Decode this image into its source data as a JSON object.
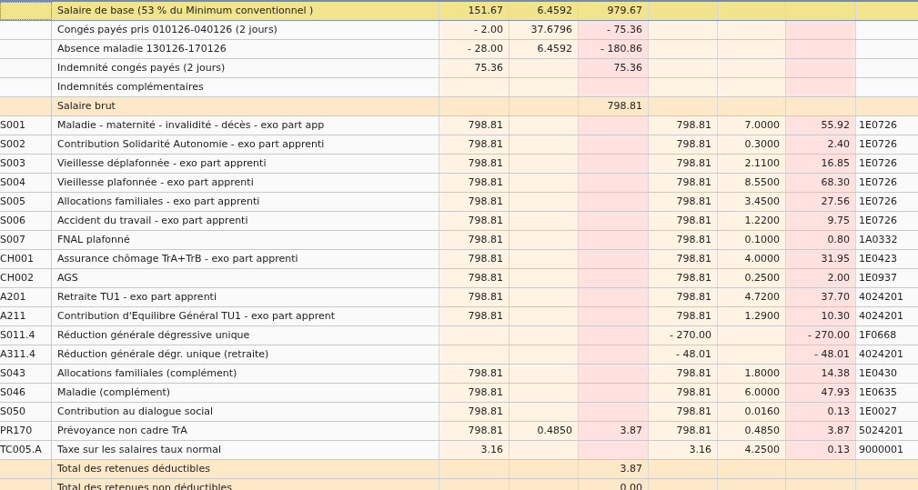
{
  "rows": [
    {
      "kind": "header",
      "focused": true,
      "cells": {
        "label": "Salaire de base (53 % du Minimum conventionnel )",
        "base": "151.67",
        "rate": "6.4592",
        "amount": "979.67"
      }
    },
    {
      "kind": "line",
      "cells": {
        "label": "Congés payés pris 010126-040126 (2 jours)",
        "base": "- 2.00",
        "rate": "37.6796",
        "amount": "- 75.36"
      }
    },
    {
      "kind": "line",
      "cells": {
        "label": "Absence maladie 130126-170126",
        "base": "- 28.00",
        "rate": "6.4592",
        "amount": "- 180.86"
      }
    },
    {
      "kind": "line",
      "cells": {
        "label": "Indemnité congés payés (2 jours)",
        "base": "75.36",
        "amount": "75.36"
      }
    },
    {
      "kind": "line",
      "cells": {
        "label": "Indemnités complémentaires"
      }
    },
    {
      "kind": "total",
      "cells": {
        "label": "Salaire brut",
        "amount": "798.81"
      }
    },
    {
      "kind": "line",
      "cells": {
        "code": "S001",
        "label": "Maladie - maternité - invalidité - décès - exo part app",
        "base": "798.81",
        "employer_base": "798.81",
        "employer_rate": "7.0000",
        "employer_amount": "55.92",
        "column_9": "1E0726"
      }
    },
    {
      "kind": "line",
      "cells": {
        "code": "S002",
        "label": "Contribution Solidarité Autonomie - exo part apprenti",
        "base": "798.81",
        "employer_base": "798.81",
        "employer_rate": "0.3000",
        "employer_amount": "2.40",
        "column_9": "1E0726"
      }
    },
    {
      "kind": "line",
      "cells": {
        "code": "S003",
        "label": "Vieillesse déplafonnée - exo part apprenti",
        "base": "798.81",
        "employer_base": "798.81",
        "employer_rate": "2.1100",
        "employer_amount": "16.85",
        "column_9": "1E0726"
      }
    },
    {
      "kind": "line",
      "cells": {
        "code": "S004",
        "label": "Vieillesse plafonnée - exo part apprenti",
        "base": "798.81",
        "employer_base": "798.81",
        "employer_rate": "8.5500",
        "employer_amount": "68.30",
        "column_9": "1E0726"
      }
    },
    {
      "kind": "line",
      "cells": {
        "code": "S005",
        "label": "Allocations familiales - exo part apprenti",
        "base": "798.81",
        "employer_base": "798.81",
        "employer_rate": "3.4500",
        "employer_amount": "27.56",
        "column_9": "1E0726"
      }
    },
    {
      "kind": "line",
      "cells": {
        "code": "S006",
        "label": "Accident du travail - exo part apprenti",
        "base": "798.81",
        "employer_base": "798.81",
        "employer_rate": "1.2200",
        "employer_amount": "9.75",
        "column_9": "1E0726"
      }
    },
    {
      "kind": "line",
      "cells": {
        "code": "S007",
        "label": "FNAL plafonné",
        "base": "798.81",
        "employer_base": "798.81",
        "employer_rate": "0.1000",
        "employer_amount": "0.80",
        "column_9": "1A0332"
      }
    },
    {
      "kind": "line",
      "cells": {
        "code": "CH001",
        "label": "Assurance chômage TrA+TrB - exo part apprenti",
        "base": "798.81",
        "employer_base": "798.81",
        "employer_rate": "4.0000",
        "employer_amount": "31.95",
        "column_9": "1E0423"
      }
    },
    {
      "kind": "line",
      "cells": {
        "code": "CH002",
        "label": "AGS",
        "base": "798.81",
        "employer_base": "798.81",
        "employer_rate": "0.2500",
        "employer_amount": "2.00",
        "column_9": "1E0937"
      }
    },
    {
      "kind": "line",
      "cells": {
        "code": "A201",
        "label": "Retraite TU1 - exo part apprenti",
        "base": "798.81",
        "employer_base": "798.81",
        "employer_rate": "4.7200",
        "employer_amount": "37.70",
        "column_9": "4024201"
      }
    },
    {
      "kind": "line",
      "cells": {
        "code": "A211",
        "label": "Contribution d'Equilibre Général TU1 - exo part apprent",
        "base": "798.81",
        "employer_base": "798.81",
        "employer_rate": "1.2900",
        "employer_amount": "10.30",
        "column_9": "4024201"
      }
    },
    {
      "kind": "line",
      "cells": {
        "code": "S011.4",
        "label": "Réduction générale dégressive unique",
        "employer_base": "- 270.00",
        "employer_amount": "- 270.00",
        "column_9": "1F0668"
      }
    },
    {
      "kind": "line",
      "cells": {
        "code": "A311.4",
        "label": "Réduction générale dégr. unique (retraite)",
        "employer_base": "- 48.01",
        "employer_amount": "- 48.01",
        "column_9": "4024201"
      }
    },
    {
      "kind": "line",
      "cells": {
        "code": "S043",
        "label": "Allocations familiales (complément)",
        "base": "798.81",
        "employer_base": "798.81",
        "employer_rate": "1.8000",
        "employer_amount": "14.38",
        "column_9": "1E0430"
      }
    },
    {
      "kind": "line",
      "cells": {
        "code": "S046",
        "label": "Maladie (complément)",
        "base": "798.81",
        "employer_base": "798.81",
        "employer_rate": "6.0000",
        "employer_amount": "47.93",
        "column_9": "1E0635"
      }
    },
    {
      "kind": "line",
      "cells": {
        "code": "S050",
        "label": "Contribution au dialogue social",
        "base": "798.81",
        "employer_base": "798.81",
        "employer_rate": "0.0160",
        "employer_amount": "0.13",
        "column_9": "1E0027"
      }
    },
    {
      "kind": "line",
      "cells": {
        "code": "PR170",
        "label": "Prévoyance non cadre TrA",
        "base": "798.81",
        "rate": "0.4850",
        "amount": "3.87",
        "employer_base": "798.81",
        "employer_rate": "0.4850",
        "employer_amount": "3.87",
        "column_9": "5024201"
      }
    },
    {
      "kind": "line",
      "cells": {
        "code": "TC005.A",
        "label": "Taxe sur les salaires taux normal",
        "base": "3.16",
        "employer_base": "3.16",
        "employer_rate": "4.2500",
        "employer_amount": "0.13",
        "column_9": "9000001"
      }
    },
    {
      "kind": "total",
      "cells": {
        "label": "Total des retenues déductibles",
        "amount": "3.87"
      }
    },
    {
      "kind": "total",
      "cells": {
        "label": "Total des retenues non déductibles",
        "amount": "0.00"
      }
    }
  ]
}
